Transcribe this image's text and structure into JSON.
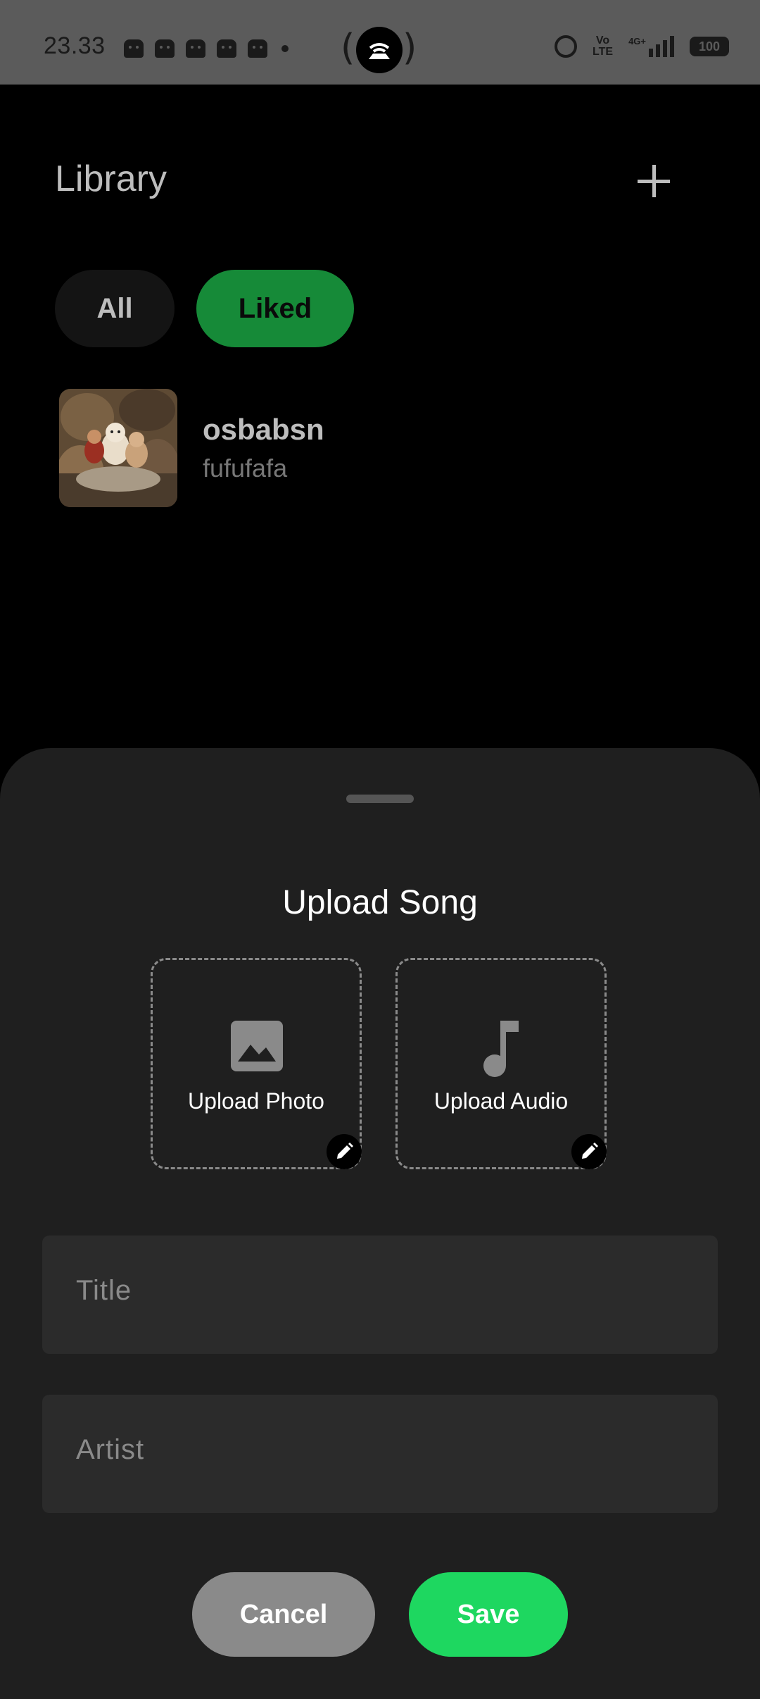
{
  "status_bar": {
    "time": "23.33",
    "volte_top": "Vo",
    "volte_bottom": "LTE",
    "network": "4G+",
    "battery": "100"
  },
  "header": {
    "title": "Library",
    "add_icon": "plus-icon"
  },
  "filters": [
    {
      "label": "All",
      "selected": false
    },
    {
      "label": "Liked",
      "selected": true
    }
  ],
  "songs": [
    {
      "title": "osbabsn",
      "artist": "fufufafa"
    }
  ],
  "upload_sheet": {
    "title": "Upload Song",
    "upload_photo_label": "Upload Photo",
    "upload_audio_label": "Upload Audio",
    "title_placeholder": "Title",
    "artist_placeholder": "Artist",
    "cancel_label": "Cancel",
    "save_label": "Save"
  },
  "colors": {
    "accent": "#1ed760",
    "liked_chip": "#168a38",
    "sheet_bg": "#1f1f1f",
    "field_bg": "#2b2b2b"
  }
}
